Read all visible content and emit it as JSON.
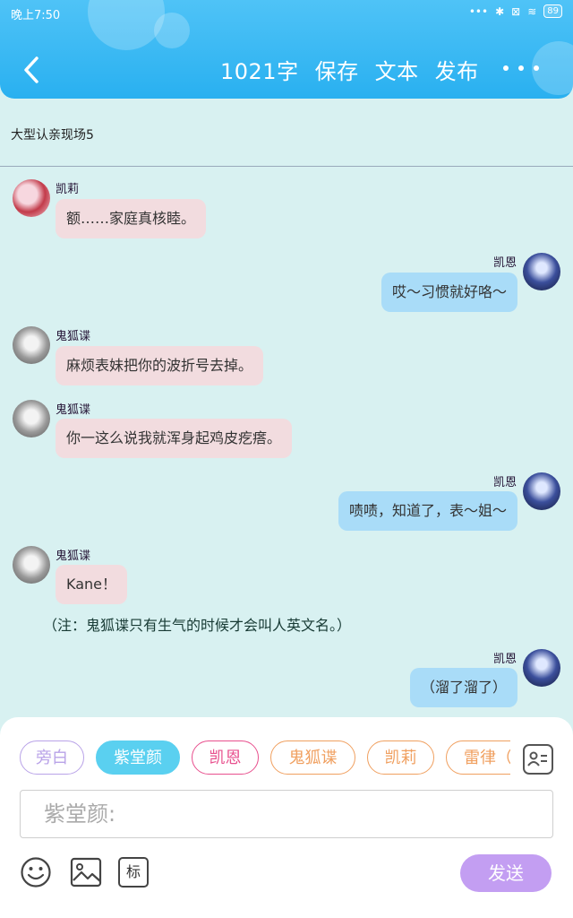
{
  "status_bar": {
    "time": "晚上7:50",
    "battery": "89"
  },
  "toolbar": {
    "word_count": "1021字",
    "save": "保存",
    "text": "文本",
    "publish": "发布"
  },
  "chapter": {
    "title": "大型认亲现场5"
  },
  "messages": [
    {
      "side": "left",
      "name": "凯莉",
      "text": "额……家庭真核睦。"
    },
    {
      "side": "right",
      "name": "凯恩",
      "text": "哎～习惯就好咯～"
    },
    {
      "side": "left",
      "name": "鬼狐谍",
      "text": "麻烦表妹把你的波折号去掉。"
    },
    {
      "side": "left",
      "name": "鬼狐谍",
      "text": "你一这么说我就浑身起鸡皮疙瘩。"
    },
    {
      "side": "right",
      "name": "凯恩",
      "text": "啧啧，知道了，表～姐～"
    },
    {
      "side": "left",
      "name": "鬼狐谍",
      "text": "Kane！"
    },
    {
      "side": "right",
      "name": "凯恩",
      "text": "（溜了溜了）"
    }
  ],
  "note": "（注：鬼狐谍只有生气的时候才会叫人英文名。）",
  "characters": [
    {
      "label": "旁白",
      "color": "#b9a3e8",
      "active": false
    },
    {
      "label": "紫堂颜",
      "color": "#5ad0f0",
      "active": true
    },
    {
      "label": "凯恩",
      "color": "#e8508e",
      "active": false
    },
    {
      "label": "鬼狐谍",
      "color": "#f0a060",
      "active": false
    },
    {
      "label": "凯莉",
      "color": "#f0a060",
      "active": false
    },
    {
      "label": "雷律（",
      "color": "#f0a060",
      "active": false
    }
  ],
  "input": {
    "placeholder": "紫堂颜:"
  },
  "bottom_tools": {
    "mark_label": "标",
    "send": "发送"
  },
  "icons": [
    "back-chevron-icon",
    "more-dots-icon",
    "contact-card-icon",
    "emoji-icon",
    "image-icon",
    "mark-icon"
  ]
}
